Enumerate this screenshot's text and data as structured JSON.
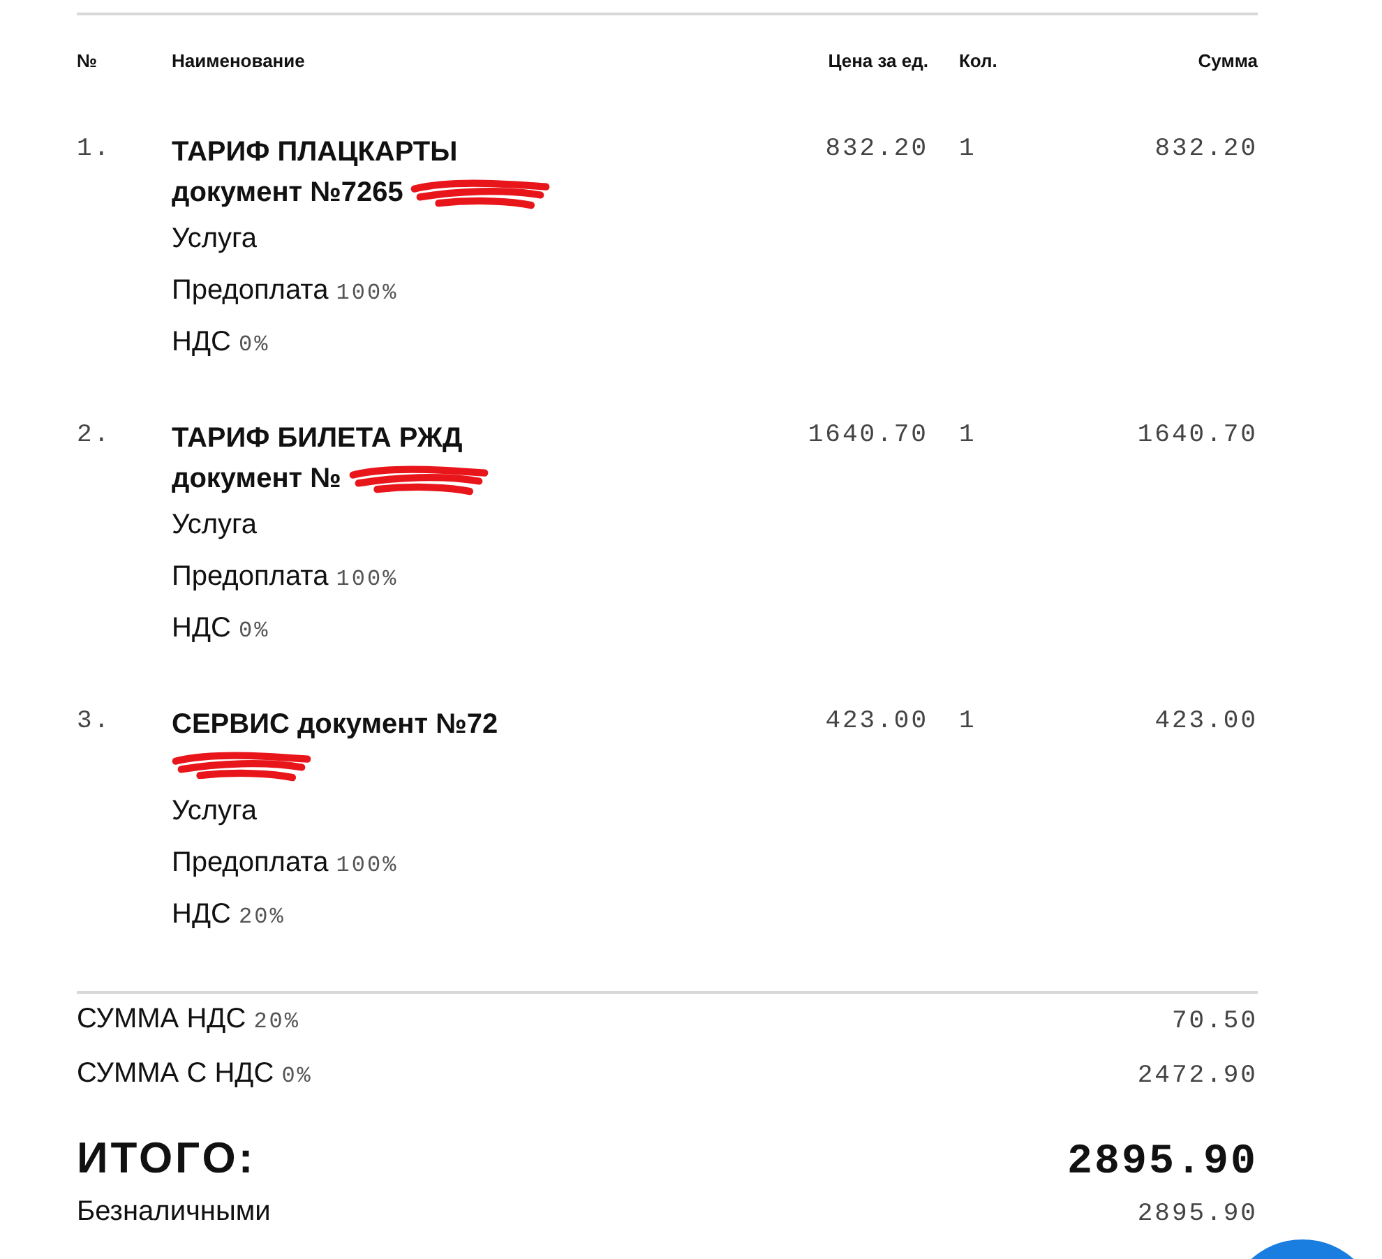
{
  "columns": {
    "number": "№",
    "name": "Наименование",
    "price": "Цена за ед.",
    "qty": "Кол.",
    "sum": "Сумма"
  },
  "items": [
    {
      "number": "1.",
      "name": "ТАРИФ ПЛАЦКАРТЫ документ №7265",
      "redacted": true,
      "type": "Услуга",
      "payment_label": "Предоплата",
      "payment_value": "100%",
      "vat_label": "НДС",
      "vat_value": "0%",
      "price": "832.20",
      "qty": "1",
      "sum": "832.20"
    },
    {
      "number": "2.",
      "name": "ТАРИФ БИЛЕТА РЖД документ №",
      "redacted": true,
      "type": "Услуга",
      "payment_label": "Предоплата",
      "payment_value": "100%",
      "vat_label": "НДС",
      "vat_value": "0%",
      "price": "1640.70",
      "qty": "1",
      "sum": "1640.70"
    },
    {
      "number": "3.",
      "name": "СЕРВИС документ №72",
      "redacted": true,
      "type": "Услуга",
      "payment_label": "Предоплата",
      "payment_value": "100%",
      "vat_label": "НДС",
      "vat_value": "20%",
      "price": "423.00",
      "qty": "1",
      "sum": "423.00"
    }
  ],
  "totals": [
    {
      "label": "СУММА НДС",
      "rate": "20%",
      "value": "70.50"
    },
    {
      "label": "СУММА С НДС",
      "rate": "0%",
      "value": "2472.90"
    }
  ],
  "grand_total": {
    "label": "ИТОГО:",
    "value": "2895.90"
  },
  "payment": {
    "label": "Безналичными",
    "value": "2895.90"
  },
  "fab": {
    "visible": true
  }
}
